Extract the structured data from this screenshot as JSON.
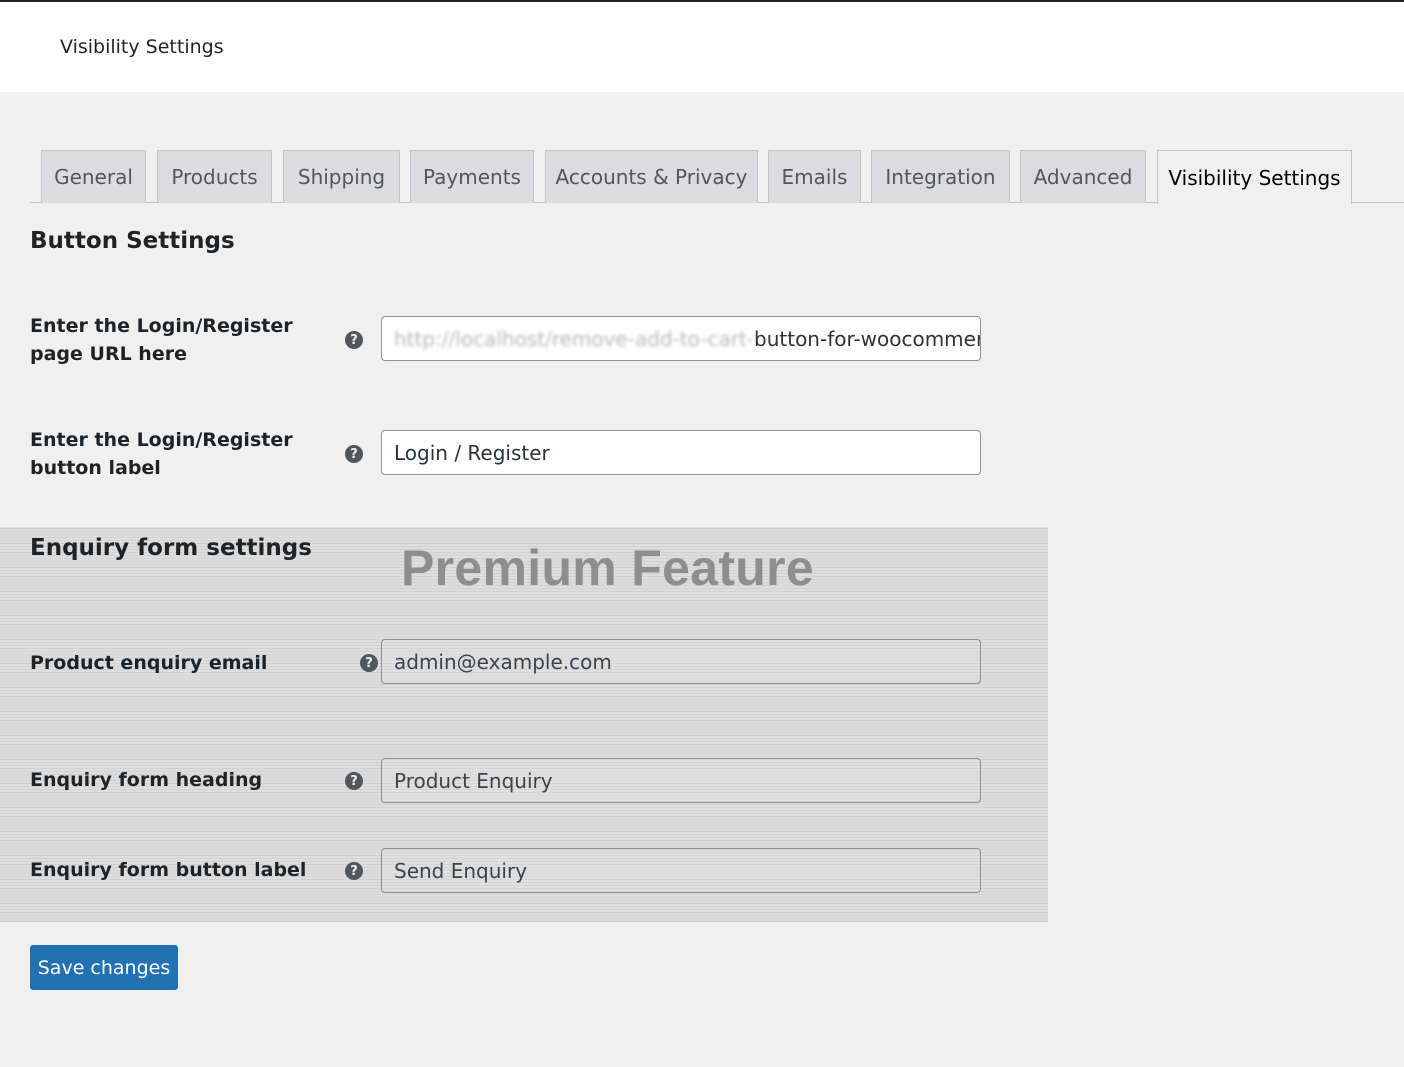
{
  "header": {
    "title": "Visibility Settings"
  },
  "tabs": [
    {
      "label": "General"
    },
    {
      "label": "Products"
    },
    {
      "label": "Shipping"
    },
    {
      "label": "Payments"
    },
    {
      "label": "Accounts & Privacy"
    },
    {
      "label": "Emails"
    },
    {
      "label": "Integration"
    },
    {
      "label": "Advanced"
    },
    {
      "label": "Visibility Settings",
      "active": true
    }
  ],
  "button_settings": {
    "title": "Button Settings",
    "login_url": {
      "label": "Enter the Login/Register page URL here",
      "value_blurred": "http://localhost/remove-add-to-cart-",
      "value_visible": "button-for-woocommerce"
    },
    "login_label": {
      "label": "Enter the Login/Register button label",
      "value": "Login / Register"
    }
  },
  "enquiry_settings": {
    "title": "Enquiry form settings",
    "watermark": "Premium Feature",
    "email": {
      "label": "Product enquiry email",
      "value": "admin@example.com"
    },
    "heading": {
      "label": "Enquiry form heading",
      "value": "Product Enquiry"
    },
    "button_label": {
      "label": "Enquiry form button label",
      "value": "Send Enquiry"
    }
  },
  "help_glyph": "?",
  "save_label": "Save changes",
  "colors": {
    "primary": "#2271b1",
    "background": "#f0f0f1",
    "tab_inactive": "#dcdcde"
  }
}
